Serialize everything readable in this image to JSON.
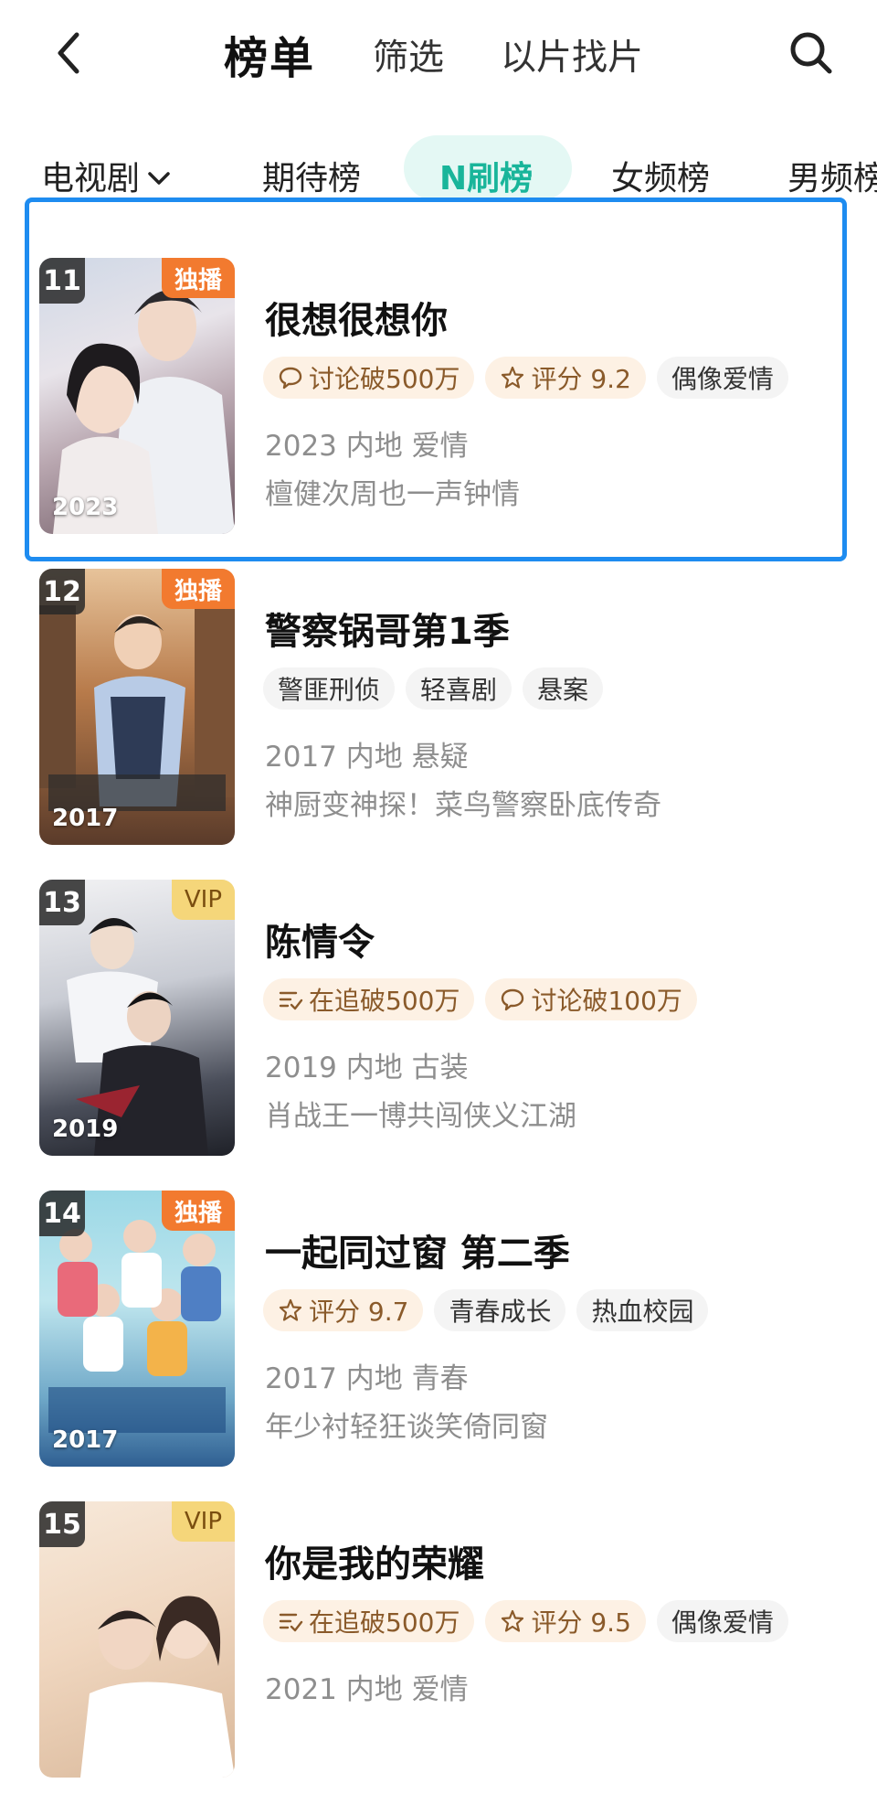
{
  "header": {
    "title": "榜单",
    "filter_label": "筛选",
    "search_by_image_label": "以片找片"
  },
  "tabs": {
    "category": "电视剧",
    "items": [
      {
        "label": "期待榜"
      },
      {
        "label": "N刷榜",
        "active": true
      },
      {
        "label": "女频榜"
      },
      {
        "label": "男频榜"
      }
    ]
  },
  "items": [
    {
      "rank": "11",
      "badge": "独播",
      "poster_year": "2023",
      "title": "很想很想你",
      "tags": [
        {
          "icon": "chat-bubble-icon",
          "text": "讨论破500万"
        },
        {
          "icon": "star-icon",
          "text": "评分 9.2"
        },
        {
          "text": "偶像爱情"
        }
      ],
      "meta": "2023 内地 爱情",
      "desc": "檀健次周也一声钟情"
    },
    {
      "rank": "12",
      "badge": "独播",
      "poster_year": "2017",
      "title": "警察锅哥第1季",
      "tags": [
        {
          "text": "警匪刑侦"
        },
        {
          "text": "轻喜剧"
        },
        {
          "text": "悬案"
        }
      ],
      "meta": "2017 内地 悬疑",
      "desc": "神厨变神探！菜鸟警察卧底传奇"
    },
    {
      "rank": "13",
      "badge": "VIP",
      "poster_year": "2019",
      "title": "陈情令",
      "tags": [
        {
          "icon": "list-check-icon",
          "text": "在追破500万"
        },
        {
          "icon": "chat-bubble-icon",
          "text": "讨论破100万"
        }
      ],
      "meta": "2019 内地 古装",
      "desc": "肖战王一博共闯侠义江湖"
    },
    {
      "rank": "14",
      "badge": "独播",
      "poster_year": "2017",
      "title": "一起同过窗 第二季",
      "tags": [
        {
          "icon": "star-icon",
          "text": "评分 9.7"
        },
        {
          "text": "青春成长"
        },
        {
          "text": "热血校园"
        }
      ],
      "meta": "2017 内地 青春",
      "desc": "年少衬轻狂谈笑倚同窗"
    },
    {
      "rank": "15",
      "badge": "VIP",
      "title": "你是我的荣耀",
      "tags": [
        {
          "icon": "list-check-icon",
          "text": "在追破500万"
        },
        {
          "icon": "star-icon",
          "text": "评分 9.5"
        },
        {
          "text": "偶像爱情"
        }
      ],
      "meta": "2021 内地 爱情"
    }
  ],
  "colors": {
    "accent": "#19b59a",
    "selection_border": "#1e8cf0",
    "exclusive_badge": "#f27a2f",
    "vip_badge": "#f5d67a",
    "hot_tag_bg": "#fdf1e4"
  }
}
